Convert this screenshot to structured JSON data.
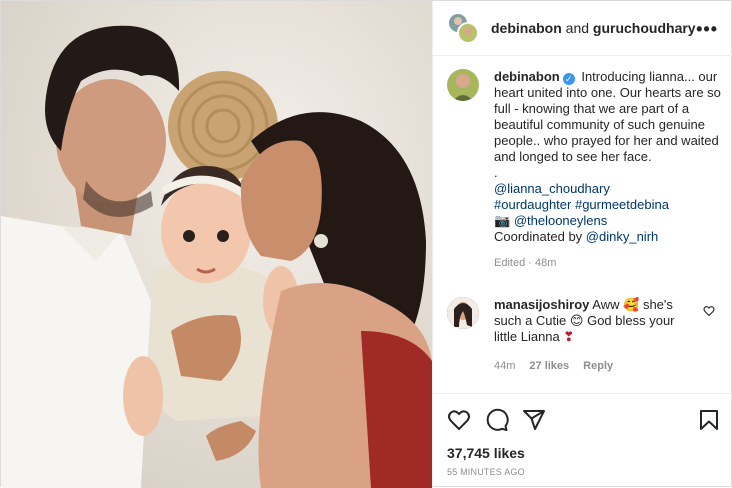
{
  "header": {
    "user1": "debinabon",
    "joiner": "and",
    "user2": "guruchoudhary",
    "more_label": "•••"
  },
  "caption": {
    "username": "debinabon",
    "lines": [
      "Introducing lianna... our heart united into one. Our hearts are so full - knowing that we are part of a beautiful community of such genuine people.. who prayed for her and waited and longed to see her face.",
      "."
    ],
    "mention_daughter": "@lianna_choudhary",
    "hashtag1": "#ourdaughter",
    "hashtag2": "#gurmeetdebina",
    "camera_emoji": "📷",
    "credit_link": "@thelooneylens",
    "coordinated_text": "Coordinated by",
    "coordinated_link": "@dinky_nirh",
    "edited": "Edited · 48m"
  },
  "comment": {
    "username": "manasijoshiroy",
    "text_1": "Aww",
    "emoji_1": "🥰",
    "text_2": "she's such a Cutie",
    "emoji_2": "😊",
    "text_3": "God bless your little Lianna",
    "emoji_3": "❣",
    "time": "44m",
    "likes": "27 likes",
    "reply": "Reply"
  },
  "post": {
    "likes": "37,745 likes",
    "timestamp": "55 MINUTES AGO"
  },
  "colors": {
    "link": "#00376b",
    "verified": "#3897f0",
    "muted": "#8e8e8e",
    "text": "#262626"
  },
  "icons": [
    "heart-icon",
    "comment-icon",
    "share-icon",
    "bookmark-icon",
    "more-icon",
    "verified-icon",
    "camera-icon"
  ]
}
